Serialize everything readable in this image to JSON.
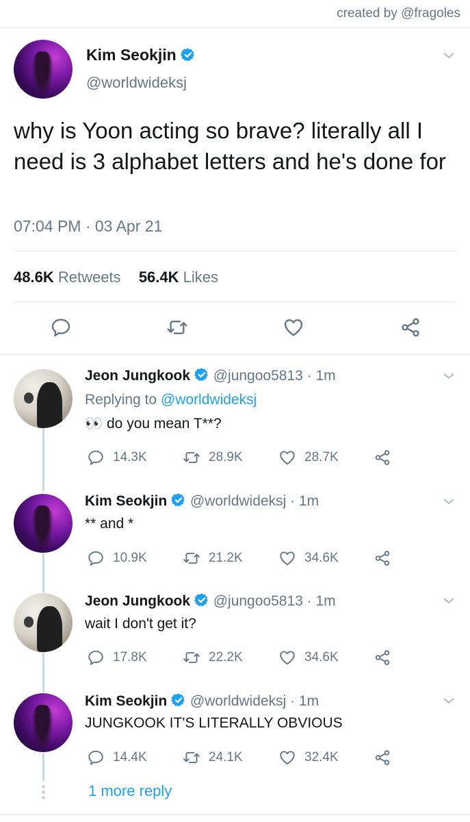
{
  "credit": "created by @fragoles",
  "main_tweet": {
    "name": "Kim Seokjin",
    "handle": "@worldwideksj",
    "text": "why is Yoon acting so brave? literally all I need is 3 alphabet letters and he's done for",
    "timestamp": "07:04 PM · 03 Apr 21",
    "retweets_count": "48.6K",
    "retweets_label": "Retweets",
    "likes_count": "56.4K",
    "likes_label": "Likes"
  },
  "replies": [
    {
      "name": "Jeon Jungkook",
      "handle": "@jungoo5813",
      "time": "· 1m",
      "replying_prefix": "Replying to",
      "replying_to": "@worldwideksj",
      "emoji": "👀",
      "text": "do you mean T**?",
      "reply_count": "14.3K",
      "retweet_count": "28.9K",
      "like_count": "28.7K"
    },
    {
      "name": "Kim Seokjin",
      "handle": "@worldwideksj",
      "time": "· 1m",
      "text": "** and *",
      "reply_count": "10.9K",
      "retweet_count": "21.2K",
      "like_count": "34.6K"
    },
    {
      "name": "Jeon Jungkook",
      "handle": "@jungoo5813",
      "time": "· 1m",
      "text": "wait I don't get it?",
      "reply_count": "17.8K",
      "retweet_count": "22.2K",
      "like_count": "34.6K"
    },
    {
      "name": "Kim Seokjin",
      "handle": "@worldwideksj",
      "time": "· 1m",
      "text": "JUNGKOOK IT'S LITERALLY OBVIOUS",
      "reply_count": "14.4K",
      "retweet_count": "24.1K",
      "like_count": "32.4K"
    }
  ],
  "more_replies": "1 more reply",
  "colors": {
    "accent": "#1da1f2",
    "muted": "#657786",
    "divider": "#e1e8ed"
  },
  "icons": [
    "verified-badge-icon",
    "chevron-down-icon",
    "reply-icon",
    "retweet-icon",
    "heart-icon",
    "share-icon"
  ]
}
